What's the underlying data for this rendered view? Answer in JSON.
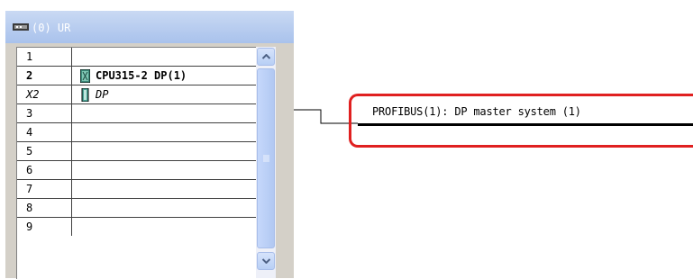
{
  "rack": {
    "title": "(0) UR",
    "icon": "rack-icon",
    "rows": [
      {
        "slot": "1",
        "module": "",
        "slot_style": "normal",
        "icon": ""
      },
      {
        "slot": "2",
        "module": "CPU315-2 DP(1)",
        "slot_style": "bold",
        "icon": "cpu-module-icon"
      },
      {
        "slot": "X2",
        "module": "DP",
        "slot_style": "italic",
        "icon": "dp-interface-icon"
      },
      {
        "slot": "3",
        "module": "",
        "slot_style": "normal",
        "icon": ""
      },
      {
        "slot": "4",
        "module": "",
        "slot_style": "normal",
        "icon": ""
      },
      {
        "slot": "5",
        "module": "",
        "slot_style": "normal",
        "icon": ""
      },
      {
        "slot": "6",
        "module": "",
        "slot_style": "normal",
        "icon": ""
      },
      {
        "slot": "7",
        "module": "",
        "slot_style": "normal",
        "icon": ""
      },
      {
        "slot": "8",
        "module": "",
        "slot_style": "normal",
        "icon": ""
      },
      {
        "slot": "9",
        "module": "",
        "slot_style": "normal",
        "icon": ""
      }
    ]
  },
  "bus": {
    "label": "PROFIBUS(1): DP master system (1)"
  },
  "colors": {
    "highlight": "#e02020",
    "title_bar": "#a9c2ec",
    "scrollbar": "#b8cff5"
  }
}
